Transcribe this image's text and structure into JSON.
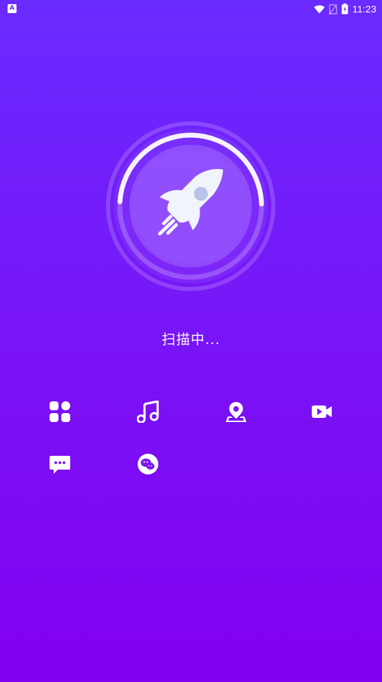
{
  "status_bar": {
    "left_icon_letter": "A",
    "time": "11:23",
    "icons": [
      "wifi-icon",
      "sim-blocked-icon",
      "battery-icon"
    ]
  },
  "scanner": {
    "icon": "rocket-icon",
    "progress": 0.5,
    "status_text": "扫描中..."
  },
  "categories": [
    {
      "name": "apps",
      "icon": "apps-grid-icon"
    },
    {
      "name": "music",
      "icon": "music-note-icon"
    },
    {
      "name": "location",
      "icon": "map-pin-icon"
    },
    {
      "name": "video",
      "icon": "video-camera-icon"
    },
    {
      "name": "messages",
      "icon": "chat-bubble-icon"
    },
    {
      "name": "wechat",
      "icon": "wechat-icon"
    }
  ],
  "colors": {
    "background_top": "#6a2bff",
    "background_bottom": "#8200f0",
    "accent_white": "#ffffff"
  }
}
